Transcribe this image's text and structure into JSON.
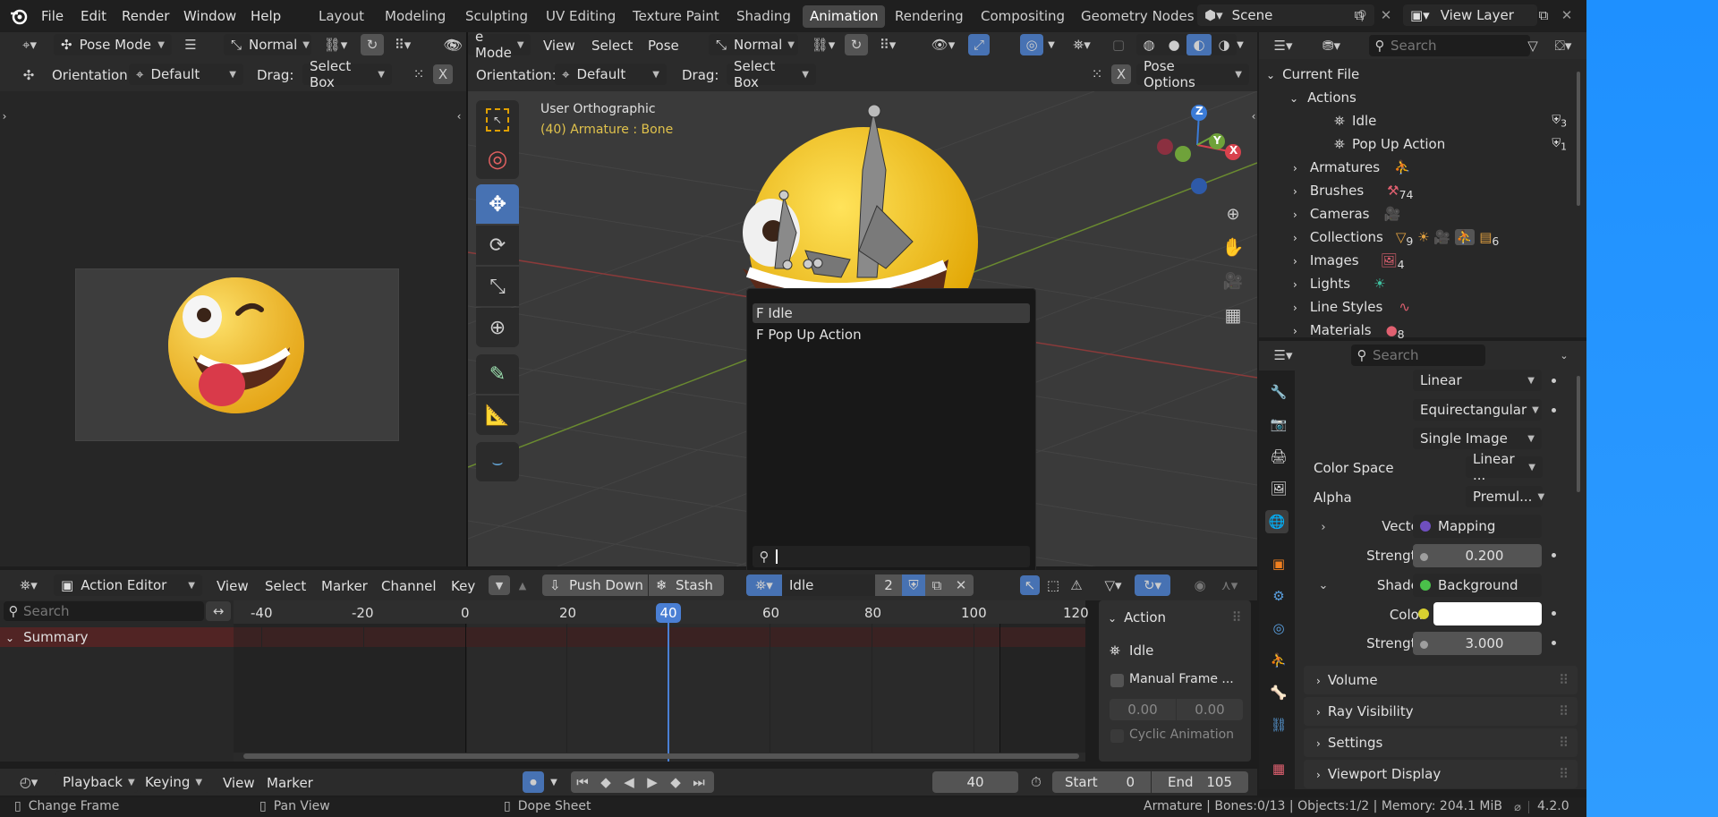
{
  "top_menu": {
    "file": "File",
    "edit": "Edit",
    "render": "Render",
    "window": "Window",
    "help": "Help"
  },
  "workspaces": [
    "Layout",
    "Modeling",
    "Sculpting",
    "UV Editing",
    "Texture Paint",
    "Shading",
    "Animation",
    "Rendering",
    "Compositing",
    "Geometry Nodes"
  ],
  "active_workspace": "Animation",
  "scene": {
    "name": "Scene",
    "view_layer": "View Layer"
  },
  "left_header": {
    "mode": "Pose Mode",
    "pivot": "Normal",
    "orientation_label": "Orientation:",
    "orientation": "Default",
    "drag_label": "Drag:",
    "drag": "Select Box",
    "close": "X"
  },
  "viewport": {
    "mode_partial": "e Mode",
    "menus": [
      "View",
      "Select",
      "Pose"
    ],
    "transform": "Normal",
    "orientation_label": "Orientation:",
    "orientation": "Default",
    "drag_label": "Drag:",
    "drag": "Select Box",
    "close": "X",
    "pose_options": "Pose Options",
    "view_name": "User Orthographic",
    "object_info": "(40) Armature : Bone",
    "gizmo": {
      "x": "X",
      "y": "Y",
      "z": "Z"
    }
  },
  "action_popup": {
    "items": [
      "F Idle",
      "F Pop Up Action"
    ],
    "search_value": ""
  },
  "outliner": {
    "search_placeholder": "Search",
    "root": "Current File",
    "actions_label": "Actions",
    "actions": [
      {
        "name": "Idle",
        "count": "3"
      },
      {
        "name": "Pop Up Action",
        "count": "1"
      }
    ],
    "categories": [
      {
        "name": "Armatures",
        "count": ""
      },
      {
        "name": "Brushes",
        "count": "74"
      },
      {
        "name": "Cameras",
        "count": ""
      },
      {
        "name": "Collections",
        "count": "9",
        "count2": "6"
      },
      {
        "name": "Images",
        "count": "4"
      },
      {
        "name": "Lights",
        "count": ""
      },
      {
        "name": "Line Styles",
        "count": ""
      },
      {
        "name": "Materials",
        "count": "8"
      }
    ]
  },
  "properties": {
    "search_placeholder": "Search",
    "interpolation": "Linear",
    "projection": "Equirectangular",
    "source": "Single Image",
    "color_space_label": "Color Space",
    "color_space": "Linear ...",
    "alpha_label": "Alpha",
    "alpha": "Premul...",
    "vector_label": "Vector",
    "vector": "Mapping",
    "strength_label": "Strength",
    "strength1": "0.200",
    "shader_label": "Shader",
    "shader": "Background",
    "color_label": "Color",
    "strength2": "3.000",
    "panels": [
      "Volume",
      "Ray Visibility",
      "Settings",
      "Viewport Display"
    ]
  },
  "action_editor": {
    "editor": "Action Editor",
    "menus": [
      "View",
      "Select",
      "Marker",
      "Channel",
      "Key"
    ],
    "push_down": "Push Down",
    "stash": "Stash",
    "action_name": "Idle",
    "users": "2",
    "search_placeholder": "Search",
    "summary": "Summary",
    "ticks": [
      "-40",
      "-20",
      "0",
      "20",
      "40",
      "60",
      "80",
      "100",
      "120"
    ],
    "current_frame": "40",
    "side_panel": {
      "title": "Action",
      "action": "Idle",
      "manual_frame": "Manual Frame ...",
      "start": "0.00",
      "end": "0.00",
      "cyclic": "Cyclic Animation"
    }
  },
  "timeline": {
    "playback": "Playback",
    "keying": "Keying",
    "view": "View",
    "marker": "Marker",
    "frame": "40",
    "start_label": "Start",
    "start": "0",
    "end_label": "End",
    "end": "105"
  },
  "status_bar": {
    "change_frame": "Change Frame",
    "pan_view": "Pan View",
    "dope_sheet": "Dope Sheet",
    "stats": "Armature | Bones:0/13 | Objects:1/2 | Memory: 204.1 MiB",
    "version": "4.2.0"
  },
  "colors": {
    "accent": "#4772b3",
    "frame_marker": "#4a7fd4",
    "summary_row": "#512424",
    "desktop": "#1e90ff",
    "object_info": "#e0c24c"
  }
}
